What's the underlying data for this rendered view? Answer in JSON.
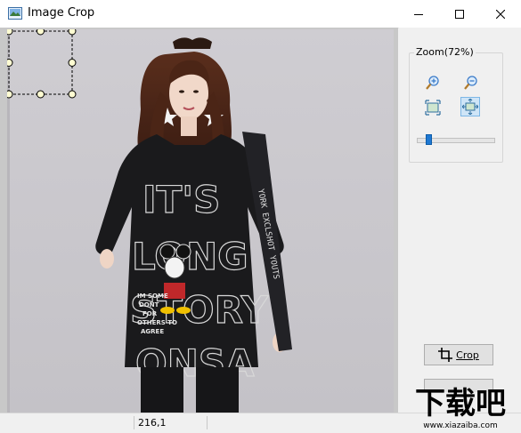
{
  "window": {
    "title": "Image Crop",
    "minimize_icon": "minimize-icon",
    "maximize_icon": "maximize-icon",
    "close_icon": "close-icon"
  },
  "canvas": {
    "shirt_text": [
      "IT'S",
      "LONG",
      "STORY",
      "ONSA"
    ],
    "mascot_text": [
      "IM SOME",
      "DONT",
      "FOR",
      "OTHERS TO",
      "AGREE"
    ],
    "strap_text": "YORK EXCLSHOT YOUTS",
    "selection_handles": 8
  },
  "zoom": {
    "label": "Zoom(72%)",
    "percent": 72,
    "tools": [
      {
        "name": "zoom-in-icon",
        "active": false
      },
      {
        "name": "zoom-out-icon",
        "active": false
      },
      {
        "name": "actual-size-icon",
        "active": false
      },
      {
        "name": "fit-window-icon",
        "active": true
      }
    ]
  },
  "actions": {
    "crop_label": "Crop",
    "crop_icon": "crop-icon"
  },
  "status": {
    "coords": "216,1"
  },
  "watermark": {
    "text": "下载吧",
    "url": "www.xiazaiba.com"
  },
  "colors": {
    "accent": "#1e78d2",
    "active_tool_bg": "#cfe5f7",
    "handle_fill": "#fffcd2"
  }
}
